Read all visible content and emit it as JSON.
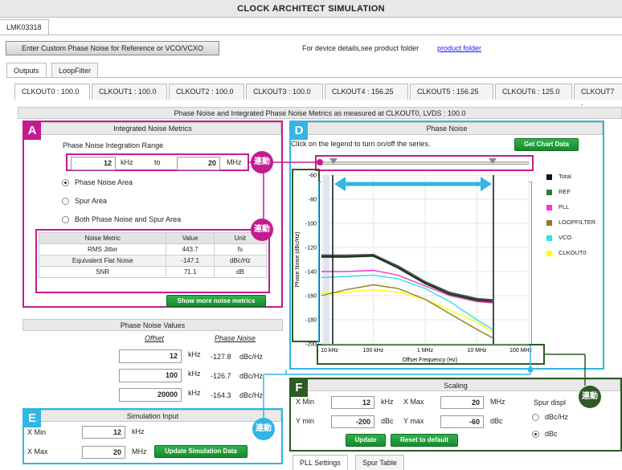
{
  "app": {
    "title": "CLOCK ARCHITECT SIMULATION",
    "device_tab": "LMK03318"
  },
  "toolbar": {
    "custom_btn": "Enter Custom Phase Noise for Reference or VCO/VCXO",
    "device_text": "For device details,see product folder",
    "product_link": "product folder"
  },
  "main_tabs": [
    {
      "label": "Outputs"
    },
    {
      "label": "LoopFilter"
    }
  ],
  "clk_tabs": [
    {
      "label": "CLKOUT0 : 100.0"
    },
    {
      "label": "CLKOUT1 : 100.0"
    },
    {
      "label": "CLKOUT2 : 100.0"
    },
    {
      "label": "CLKOUT3 : 100.0"
    },
    {
      "label": "CLKOUT4 : 156.25"
    },
    {
      "label": "CLKOUT5 : 156.25"
    },
    {
      "label": "CLKOUT6 : 125.0"
    },
    {
      "label": "CLKOUT7 :"
    }
  ],
  "banner": "Phase Noise and Integrated Phase Noise Metrics as measured at CLKOUT0, LVDS : 100.0",
  "integrated": {
    "title": "Integrated Noise Metrics",
    "range_label": "Phase Noise Integration Range",
    "from": "12",
    "from_unit": "kHz",
    "to": "to",
    "to_val": "20",
    "to_unit": "MHz",
    "radio1": "Phase Noise Area",
    "radio2": "Spur Area",
    "radio3": "Both Phase Noise and Spur Area",
    "headers": [
      "Noise Metric",
      "Value",
      "Unit"
    ],
    "rows": [
      {
        "m": "RMS Jitter",
        "v": "443.7",
        "u": "fs"
      },
      {
        "m": "Equivalent Flat Noise",
        "v": "-147.1",
        "u": "dBc/Hz"
      },
      {
        "m": "SNR",
        "v": "71.1",
        "u": "dB"
      }
    ],
    "more_btn": "Show more noise metrics"
  },
  "pnv": {
    "title": "Phase Noise Values",
    "col1": "Offset",
    "col2": "Phase Noise",
    "rows": [
      {
        "off": "12",
        "unit": "kHz",
        "pn": "-127.8",
        "pu": "dBc/Hz"
      },
      {
        "off": "100",
        "unit": "kHz",
        "pn": "-126.7",
        "pu": "dBc/Hz"
      },
      {
        "off": "20000",
        "unit": "kHz",
        "pn": "-164.3",
        "pu": "dBc/Hz"
      }
    ]
  },
  "sim": {
    "title": "Simulation Input",
    "xmin_label": "X Min",
    "xmin": "12",
    "xmin_unit": "kHz",
    "xmax_label": "X Max",
    "xmax": "20",
    "xmax_unit": "MHz",
    "update_btn": "Update Simulation Data"
  },
  "phase_noise": {
    "title": "Phase Noise",
    "hint": "Click on the legend to turn on/off the series.",
    "chart_btn": "Get Chart Data"
  },
  "scaling": {
    "title": "Scaling",
    "xmin_label": "X Min",
    "xmin": "12",
    "xmin_unit": "kHz",
    "xmax_label": "X Max",
    "xmax": "20",
    "xmax_unit": "MHz",
    "ymin_label": "Y min",
    "ymin": "-200",
    "ymin_unit": "dBc",
    "ymax_label": "Y max",
    "ymax": "-60",
    "ymax_unit": "dBc",
    "spur_label": "Spur displ",
    "spur1": "dBc/Hz",
    "spur2": "dBc",
    "update_btn": "Update",
    "reset_btn": "Reset to default"
  },
  "bottom_tabs": [
    {
      "label": "PLL Settings"
    },
    {
      "label": "Spur Table"
    }
  ],
  "badges": {
    "A": "A",
    "D": "D",
    "E": "E",
    "F": "F"
  },
  "link_label": "連動",
  "chart_data": {
    "type": "line",
    "ylabel": "Phase Noise (dBc/Hz)",
    "xlabel": "Offset Frequency (Hz)",
    "x_ticks": [
      "10 kHz",
      "100 kHz",
      "1 MHz",
      "10 MHz",
      "100 MHz"
    ],
    "y_ticks": [
      "-60",
      "-80",
      "-100",
      "-120",
      "-140",
      "-160",
      "-180",
      "-200"
    ],
    "ylim": [
      -200,
      -60
    ],
    "x": [
      10000,
      30000,
      100000,
      300000,
      1000000,
      3000000,
      10000000,
      20000000
    ],
    "series": [
      {
        "name": "Total",
        "color": "#111111",
        "values": [
          -127,
          -127,
          -126.5,
          -136,
          -149,
          -158,
          -163,
          -164
        ]
      },
      {
        "name": "REF",
        "color": "#2e7d32",
        "values": [
          -128,
          -128,
          -127,
          -137,
          -150,
          -159,
          -164,
          -165
        ]
      },
      {
        "name": "PLL",
        "color": "#ff33cc",
        "values": [
          -140,
          -140,
          -139,
          -143,
          -152,
          -160,
          -165,
          -166
        ]
      },
      {
        "name": "LOOPFILTER",
        "color": "#8c8020",
        "values": [
          -160,
          -155,
          -151,
          -154,
          -163,
          -175,
          -188,
          -195
        ]
      },
      {
        "name": "VCO",
        "color": "#33e0e6",
        "values": [
          -145,
          -144,
          -143,
          -146,
          -154,
          -165,
          -180,
          -188
        ]
      },
      {
        "name": "CLKOUT0",
        "color": "#ffff00",
        "values": [
          -158,
          -157,
          -155,
          -157,
          -163,
          -172,
          -182,
          -190
        ]
      }
    ],
    "legend": "right"
  }
}
